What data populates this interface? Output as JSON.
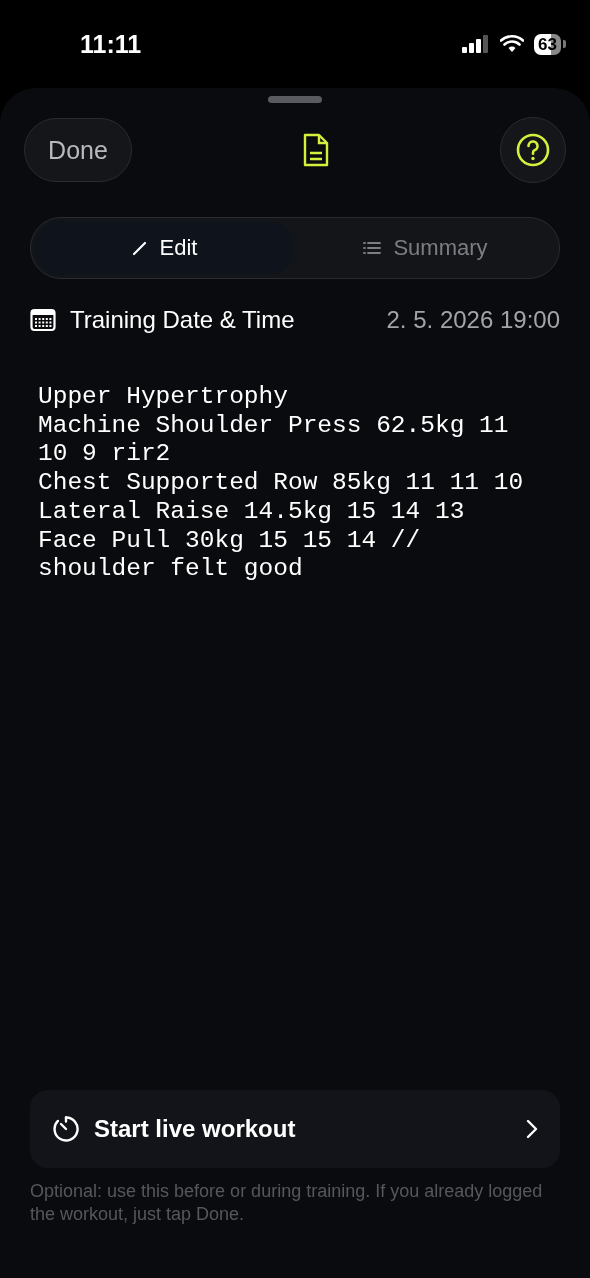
{
  "status_bar": {
    "time": "11:11",
    "battery": "63"
  },
  "header": {
    "done_label": "Done"
  },
  "tabs": [
    {
      "label": "Edit",
      "kind": "edit",
      "selected": true
    },
    {
      "label": "Summary",
      "kind": "summary",
      "selected": false
    }
  ],
  "date_row": {
    "label": "Training Date & Time",
    "value": "2. 5. 2026 19:00"
  },
  "notes": {
    "value": "Upper Hypertrophy\nMachine Shoulder Press 62.5kg 11 10 9 rir2\nChest Supported Row 85kg 11 11 10\nLateral Raise 14.5kg 15 14 13\nFace Pull 30kg 15 15 14 // shoulder felt good"
  },
  "live_workout": {
    "label": "Start live workout",
    "hint": "Optional: use this before or during training. If you already logged the workout, just tap Done."
  }
}
